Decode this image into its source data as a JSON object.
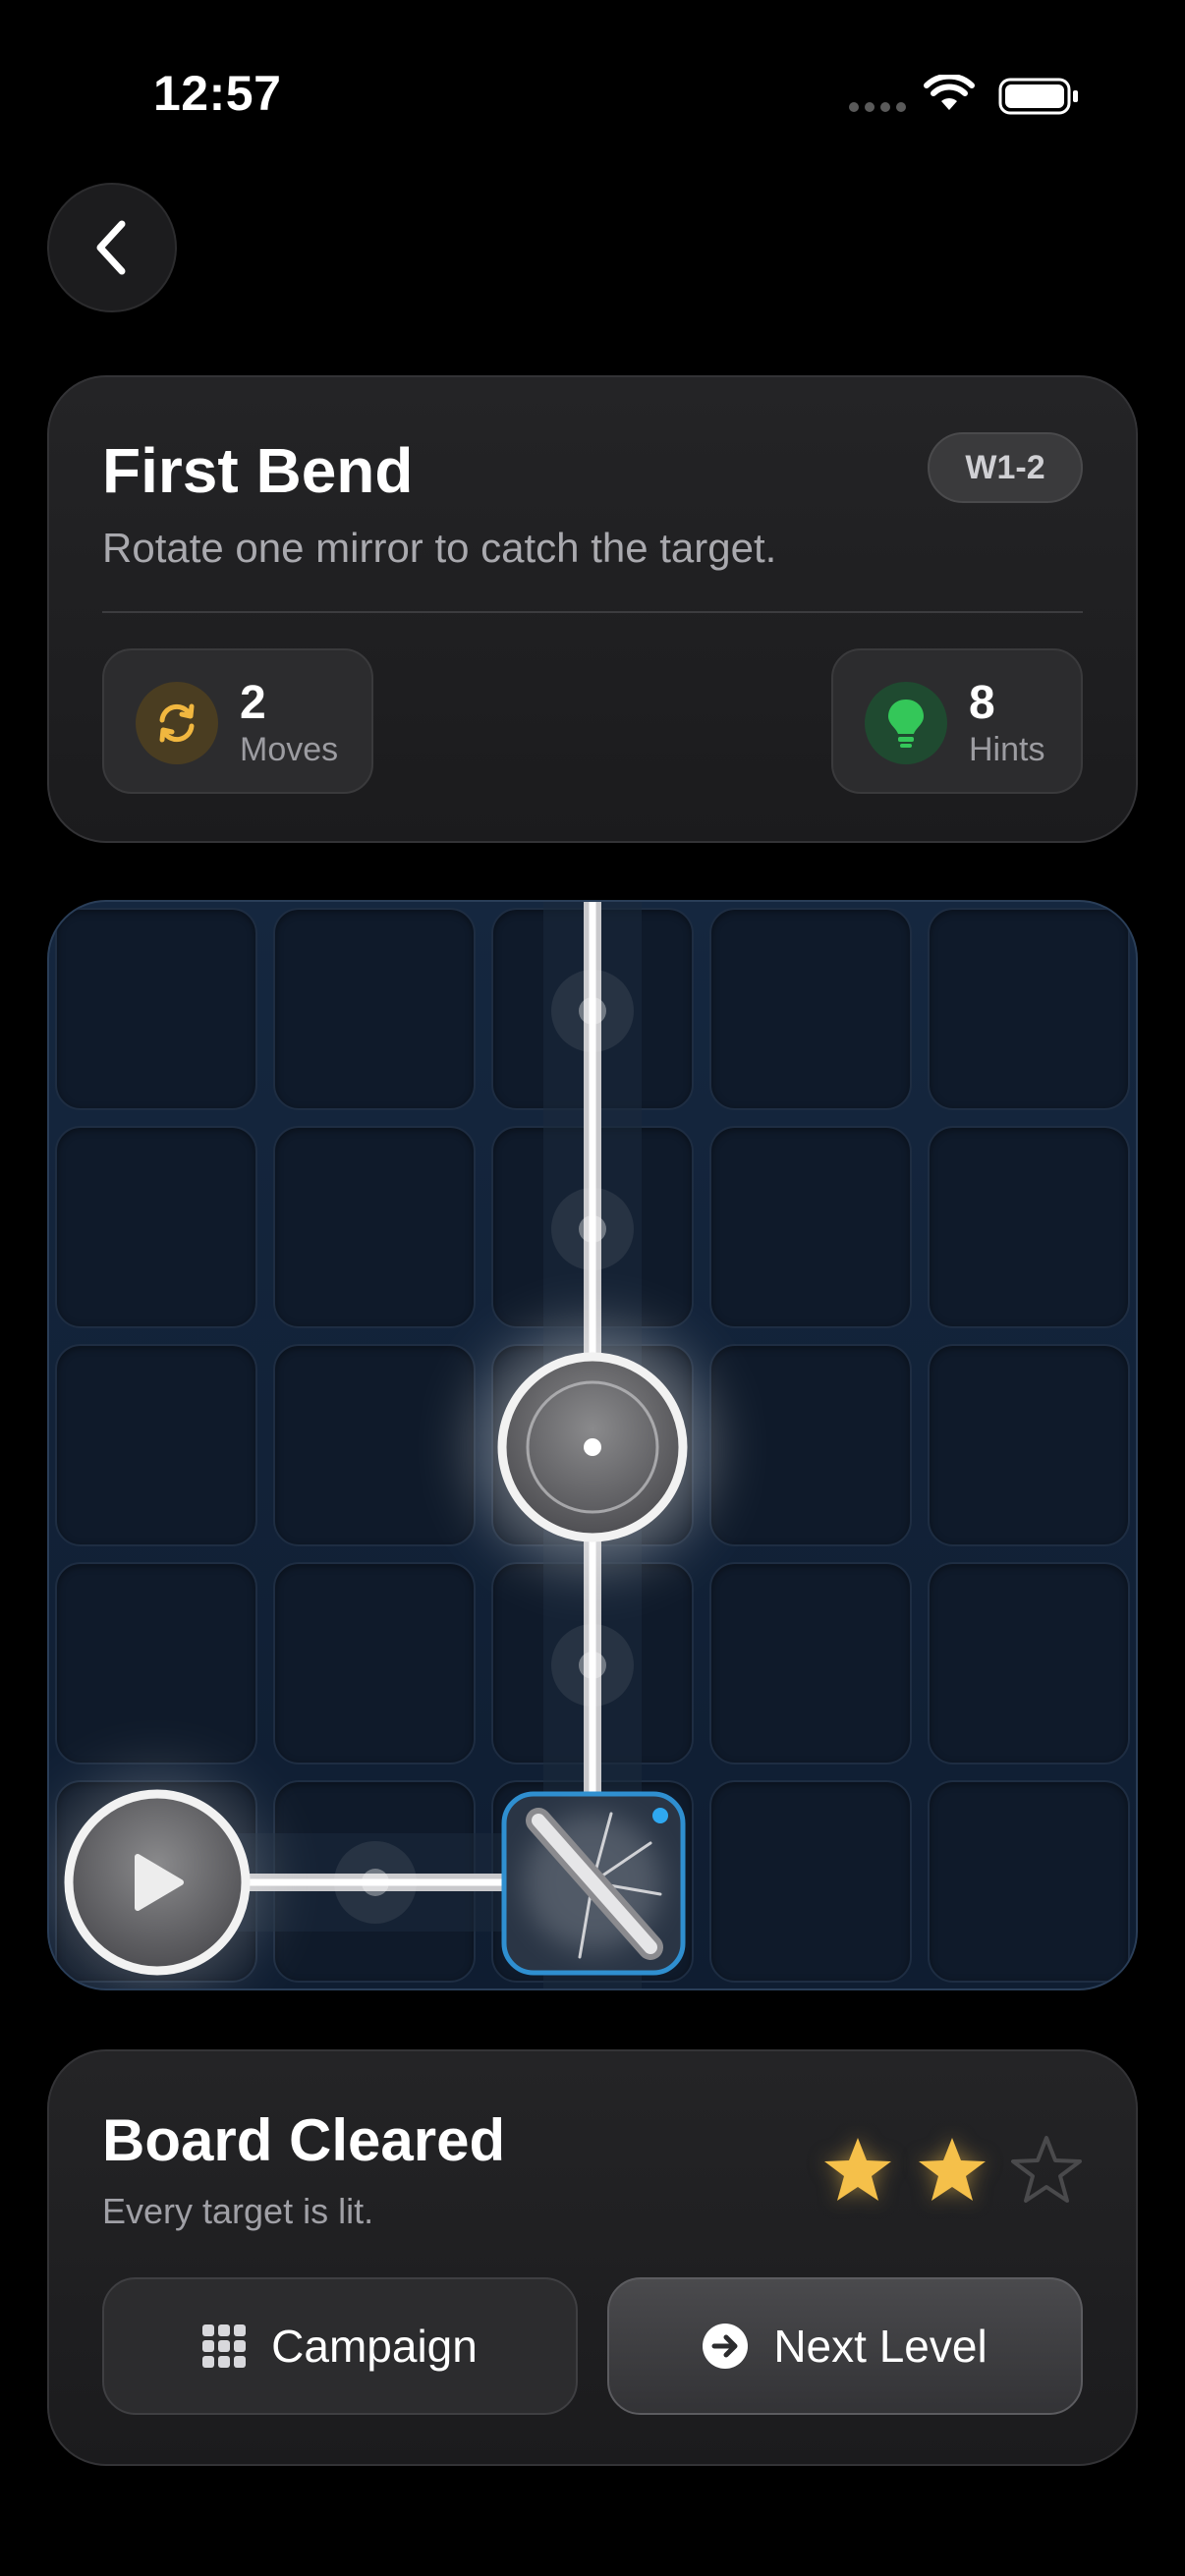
{
  "status_bar": {
    "time": "12:57"
  },
  "level": {
    "title": "First Bend",
    "badge": "W1-2",
    "subtitle": "Rotate one mirror to catch the target.",
    "stats": {
      "moves": {
        "value": "2",
        "label": "Moves",
        "icon": "rotate-arrows-icon"
      },
      "hints": {
        "value": "8",
        "label": "Hints",
        "icon": "lightbulb-icon"
      }
    }
  },
  "board": {
    "rows": 5,
    "cols": 5,
    "emitter": {
      "row": 4,
      "col": 0,
      "icon": "play-icon"
    },
    "target": {
      "row": 2,
      "col": 2,
      "lit": true
    },
    "mirror": {
      "row": 4,
      "col": 2,
      "selected": true
    },
    "beam_path": [
      [
        4,
        0
      ],
      [
        4,
        1
      ],
      [
        4,
        2
      ],
      [
        3,
        2
      ],
      [
        2,
        2
      ],
      [
        1,
        2
      ],
      [
        0,
        2
      ]
    ]
  },
  "result": {
    "title": "Board Cleared",
    "subtitle": "Every target is lit.",
    "stars_earned": 2,
    "stars_total": 3,
    "campaign_label": "Campaign",
    "next_label": "Next Level"
  },
  "colors": {
    "star_filled": "#f5c04a",
    "star_empty": "#4a4a4c",
    "moves_accent": "#f1b73f",
    "hints_accent": "#34c759",
    "board_bg": "#13233a"
  }
}
